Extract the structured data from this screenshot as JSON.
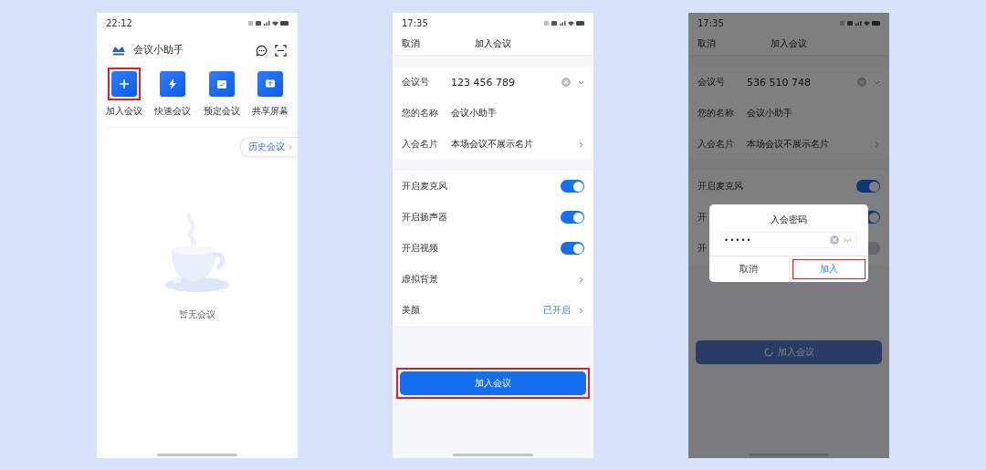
{
  "phones": [
    {
      "kind": "home",
      "time": "22:12",
      "app_title": "会议小助手",
      "actions": [
        {
          "label": "加入会议",
          "highlighted": true
        },
        {
          "label": "快速会议",
          "highlighted": false
        },
        {
          "label": "预定会议",
          "highlighted": false
        },
        {
          "label": "共享屏幕",
          "highlighted": false
        }
      ],
      "history_button": "历史会议",
      "empty_text": "暂无会议"
    },
    {
      "kind": "join",
      "time": "17:35",
      "dimmed": false,
      "nav": {
        "cancel": "取消",
        "title": "加入会议"
      },
      "fields": [
        {
          "kind": "number",
          "label": "会议号",
          "value": "123 456 789"
        },
        {
          "kind": "text",
          "label": "您的名称",
          "value": "会议小助手"
        },
        {
          "kind": "link",
          "label": "入会名片",
          "value": "本场会议不展示名片"
        }
      ],
      "settings": [
        {
          "kind": "toggle",
          "label": "开启麦克风",
          "on": true
        },
        {
          "kind": "toggle",
          "label": "开启扬声器",
          "on": true
        },
        {
          "kind": "toggle",
          "label": "开启视频",
          "on": true
        },
        {
          "kind": "link",
          "label": "虚拟背景"
        },
        {
          "kind": "link",
          "label": "美颜",
          "value": "已开启"
        }
      ],
      "join_button": {
        "label": "加入会议",
        "highlighted": true,
        "loading": false
      }
    },
    {
      "kind": "join",
      "time": "17:35",
      "dimmed": true,
      "nav": {
        "cancel": "取消",
        "title": "加入会议"
      },
      "fields": [
        {
          "kind": "number",
          "label": "会议号",
          "value": "536 510 748"
        },
        {
          "kind": "text",
          "label": "您的名称",
          "value": "会议小助手"
        },
        {
          "kind": "link",
          "label": "入会名片",
          "value": "本场会议不展示名片"
        }
      ],
      "settings": [
        {
          "kind": "toggle",
          "label": "开启麦克风",
          "on": true
        },
        {
          "kind": "toggle",
          "label": "开",
          "on": true
        },
        {
          "kind": "toggle",
          "label": "开",
          "on": false
        }
      ],
      "join_button": {
        "label": "加入会议",
        "highlighted": false,
        "loading": true
      },
      "dialog": {
        "title": "入会密码",
        "value": "•••••",
        "buttons": [
          {
            "label": "取消",
            "highlighted": false
          },
          {
            "label": "加入",
            "highlighted": true
          }
        ]
      }
    }
  ]
}
